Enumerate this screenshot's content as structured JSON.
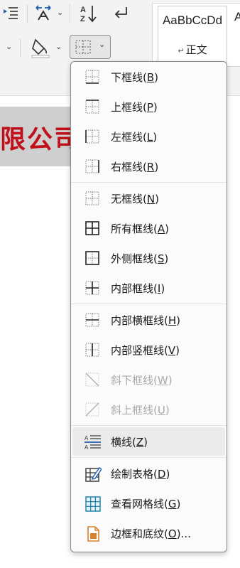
{
  "ribbon": {
    "buttons": [
      {
        "name": "increase-indent",
        "icon": "increase-indent-icon"
      },
      {
        "name": "asian-layout",
        "icon": "asian-layout-icon"
      },
      {
        "name": "sort",
        "icon": "sort-icon"
      },
      {
        "name": "show-paragraph-marks",
        "icon": "return-arrow-icon"
      },
      {
        "name": "shading",
        "icon": "paint-bucket-icon"
      },
      {
        "name": "borders",
        "icon": "borders-icon"
      }
    ],
    "styles_gallery": {
      "preview_text": "AaBbCcDd",
      "style_name": "正文",
      "next_preview": "A"
    }
  },
  "document": {
    "title_fragment": "限公司"
  },
  "borders_menu": {
    "items": [
      {
        "label": "下框线",
        "key": "B",
        "icon": "bottom-border-icon",
        "enabled": true
      },
      {
        "label": "上框线",
        "key": "P",
        "icon": "top-border-icon",
        "enabled": true
      },
      {
        "label": "左框线",
        "key": "L",
        "icon": "left-border-icon",
        "enabled": true
      },
      {
        "label": "右框线",
        "key": "R",
        "icon": "right-border-icon",
        "enabled": true
      },
      {
        "label": "无框线",
        "key": "N",
        "icon": "no-border-icon",
        "enabled": true
      },
      {
        "label": "所有框线",
        "key": "A",
        "icon": "all-borders-icon",
        "enabled": true
      },
      {
        "label": "外侧框线",
        "key": "S",
        "icon": "outside-borders-icon",
        "enabled": true
      },
      {
        "label": "内部框线",
        "key": "I",
        "icon": "inside-borders-icon",
        "enabled": true
      },
      {
        "label": "内部横框线",
        "key": "H",
        "icon": "inside-horizontal-border-icon",
        "enabled": true
      },
      {
        "label": "内部竖框线",
        "key": "V",
        "icon": "inside-vertical-border-icon",
        "enabled": true
      },
      {
        "label": "斜下框线",
        "key": "W",
        "icon": "diagonal-down-border-icon",
        "enabled": false
      },
      {
        "label": "斜上框线",
        "key": "U",
        "icon": "diagonal-up-border-icon",
        "enabled": false
      },
      {
        "label": "横线",
        "key": "Z",
        "icon": "horizontal-line-icon",
        "enabled": true,
        "highlighted": true
      },
      {
        "label": "绘制表格",
        "key": "D",
        "icon": "draw-table-icon",
        "enabled": true
      },
      {
        "label": "查看网格线",
        "key": "G",
        "icon": "view-gridlines-icon",
        "enabled": true
      },
      {
        "label": "边框和底纹",
        "key": "O",
        "suffix": "...",
        "icon": "borders-and-shading-icon",
        "enabled": true
      }
    ]
  },
  "colors": {
    "accent_blue": "#1f5fb0",
    "title_red": "#c0101a",
    "icon_orange": "#d9822b",
    "gridline_teal": "#1a7fa8"
  }
}
